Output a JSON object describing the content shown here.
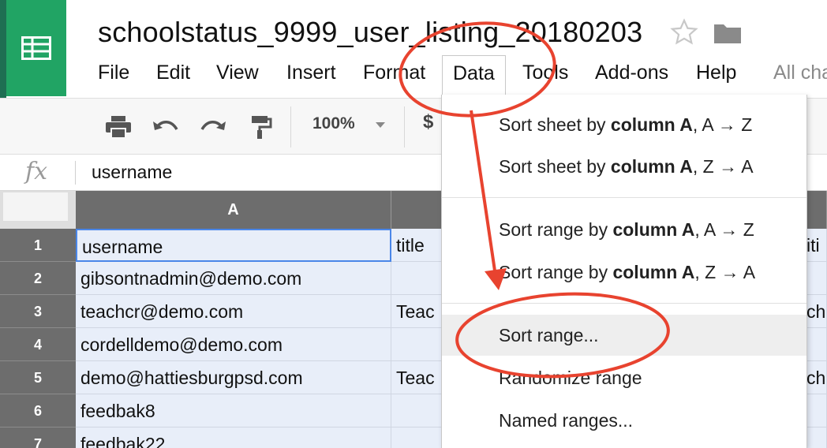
{
  "doc": {
    "title": "schoolstatus_9999_user_listing_20180203"
  },
  "menu": {
    "items": [
      "File",
      "Edit",
      "View",
      "Insert",
      "Format",
      "Data",
      "Tools",
      "Add-ons",
      "Help"
    ],
    "last_edit": "All cha"
  },
  "toolbar": {
    "zoom": "100%",
    "currency": "$"
  },
  "formula": {
    "fx": "fx",
    "value": "username"
  },
  "grid": {
    "col_a": "A",
    "rows": [
      {
        "num": "1",
        "a": "username",
        "b": "title",
        "c": "iti"
      },
      {
        "num": "2",
        "a": "gibsontnadmin@demo.com",
        "b": "",
        "c": ""
      },
      {
        "num": "3",
        "a": "teachcr@demo.com",
        "b": "Teac",
        "c": "ch"
      },
      {
        "num": "4",
        "a": "cordelldemo@demo.com",
        "b": "",
        "c": ""
      },
      {
        "num": "5",
        "a": "demo@hattiesburgpsd.com",
        "b": "Teac",
        "c": "ch"
      },
      {
        "num": "6",
        "a": "feedbak8",
        "b": "",
        "c": ""
      },
      {
        "num": "7",
        "a": "feedbak22",
        "b": "",
        "c": ""
      }
    ]
  },
  "data_menu": {
    "sort_sheet_az": {
      "pre": "Sort sheet by ",
      "col": "column A",
      "post": ", A → Z"
    },
    "sort_sheet_za": {
      "pre": "Sort sheet by ",
      "col": "column A",
      "post": ", Z → A"
    },
    "sort_range_az": {
      "pre": "Sort range by ",
      "col": "column A",
      "post": ", A → Z"
    },
    "sort_range_za": {
      "pre": "Sort range by ",
      "col": "column A",
      "post": ", Z → A"
    },
    "sort_range": "Sort range...",
    "randomize": "Randomize range",
    "named_ranges": "Named ranges..."
  },
  "colors": {
    "brand": "#21a464",
    "annotation": "#e8432f",
    "selection": "#4a86e8"
  }
}
